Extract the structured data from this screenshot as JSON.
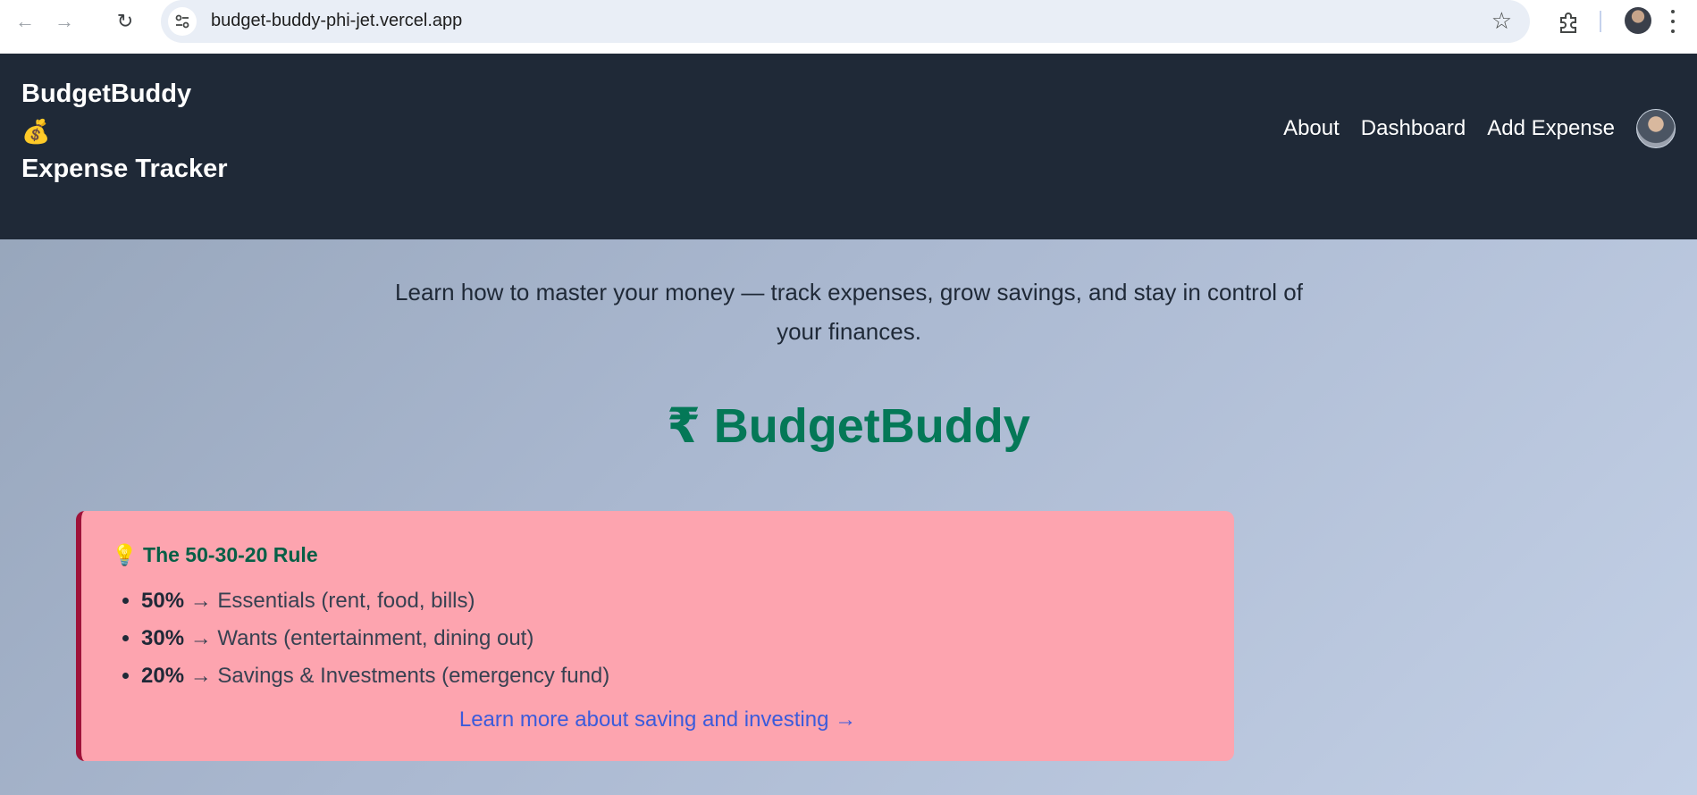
{
  "browser": {
    "url": "budget-buddy-phi-jet.vercel.app",
    "back_glyph": "←",
    "forward_glyph": "→",
    "reload_glyph": "↻",
    "bookmark_glyph": "☆"
  },
  "header": {
    "brand_line1": "BudgetBuddy",
    "brand_emoji": "💰",
    "brand_line2": "Expense Tracker",
    "nav": {
      "about": "About",
      "dashboard": "Dashboard",
      "add_expense": "Add Expense"
    }
  },
  "hero": {
    "tagline": "Learn how to master your money — track expenses, grow savings, and stay in control of your finances.",
    "title": "₹ BudgetBuddy"
  },
  "rule_card": {
    "title_icon": "💡",
    "title": "The 50-30-20 Rule",
    "items": [
      {
        "percent": "50%",
        "text": " → Essentials (rent, food, bills)"
      },
      {
        "percent": "30%",
        "text": " → Wants (entertainment, dining out)"
      },
      {
        "percent": "20%",
        "text": " → Savings & Investments (emergency fund)"
      }
    ],
    "link": "Learn more about saving and investing →"
  },
  "colors": {
    "header_bg": "#1f2937",
    "brand_green": "#047857",
    "card_bg": "#fda4af",
    "card_border": "#9f1239",
    "link_blue": "#3b5bdb"
  }
}
